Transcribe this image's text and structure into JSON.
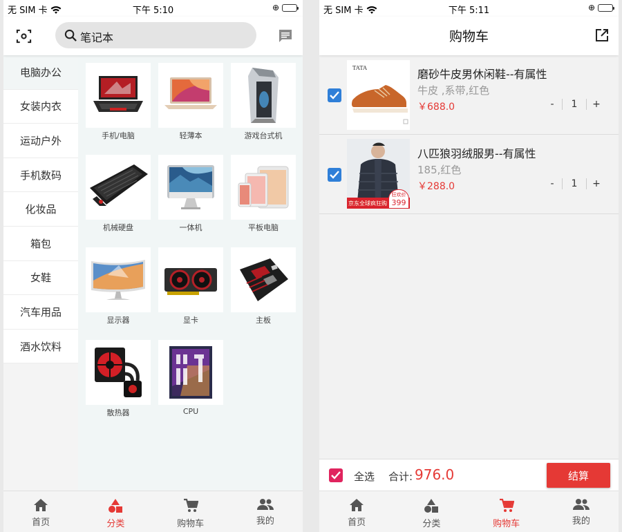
{
  "left": {
    "status": {
      "carrier": "无 SIM 卡",
      "time": "下午 5:10"
    },
    "search": {
      "text": "笔记本"
    },
    "categories": [
      "电脑办公",
      "女装内衣",
      "运动户外",
      "手机数码",
      "化妆品",
      "箱包",
      "女鞋",
      "汽车用品",
      "酒水饮料"
    ],
    "active_category": "电脑办公",
    "products": [
      {
        "label": "手机/电脑",
        "icon": "gaming-laptop-image"
      },
      {
        "label": "轻薄本",
        "icon": "thin-laptop-image"
      },
      {
        "label": "游戏台式机",
        "icon": "gaming-desktop-image"
      },
      {
        "label": "机械硬盘",
        "icon": "mechanical-keyboard-image"
      },
      {
        "label": "一体机",
        "icon": "all-in-one-image"
      },
      {
        "label": "平板电脑",
        "icon": "tablet-image"
      },
      {
        "label": "显示器",
        "icon": "monitor-image"
      },
      {
        "label": "显卡",
        "icon": "graphics-card-image"
      },
      {
        "label": "主板",
        "icon": "motherboard-image"
      },
      {
        "label": "散热器",
        "icon": "cooler-image"
      },
      {
        "label": "CPU",
        "icon": "cpu-image"
      }
    ],
    "tabs": [
      {
        "label": "首页",
        "icon": "home-icon"
      },
      {
        "label": "分类",
        "icon": "category-icon"
      },
      {
        "label": "购物车",
        "icon": "cart-icon"
      },
      {
        "label": "我的",
        "icon": "people-icon"
      }
    ],
    "active_tab": "分类"
  },
  "right": {
    "status": {
      "carrier": "无 SIM 卡",
      "time": "下午 5:11"
    },
    "title": "购物车",
    "items": [
      {
        "title": "磨砂牛皮男休闲鞋--有属性",
        "attr": "牛皮 ,系带,红色",
        "price": "￥688.0",
        "qty": "1",
        "minus": "-",
        "plus": "+",
        "brand": "TATA"
      },
      {
        "title": "八匹狼羽绒服男--有属性",
        "attr": "185,红色",
        "price": "￥288.0",
        "qty": "1",
        "minus": "-",
        "plus": "+",
        "badge": "京东全球疯狂购",
        "badge_price": "399",
        "badge_tag": "狂欢价"
      }
    ],
    "footer": {
      "select_all": "全选",
      "total_label": "合计:",
      "total_value": "976.0",
      "checkout": "结算"
    },
    "tabs": [
      {
        "label": "首页",
        "icon": "home-icon"
      },
      {
        "label": "分类",
        "icon": "category-icon"
      },
      {
        "label": "购物车",
        "icon": "cart-icon"
      },
      {
        "label": "我的",
        "icon": "people-icon"
      }
    ],
    "active_tab": "购物车"
  },
  "colors": {
    "accent": "#e53935",
    "checkbox": "#2f7fd8",
    "select_all_checkbox": "#e0245e"
  }
}
